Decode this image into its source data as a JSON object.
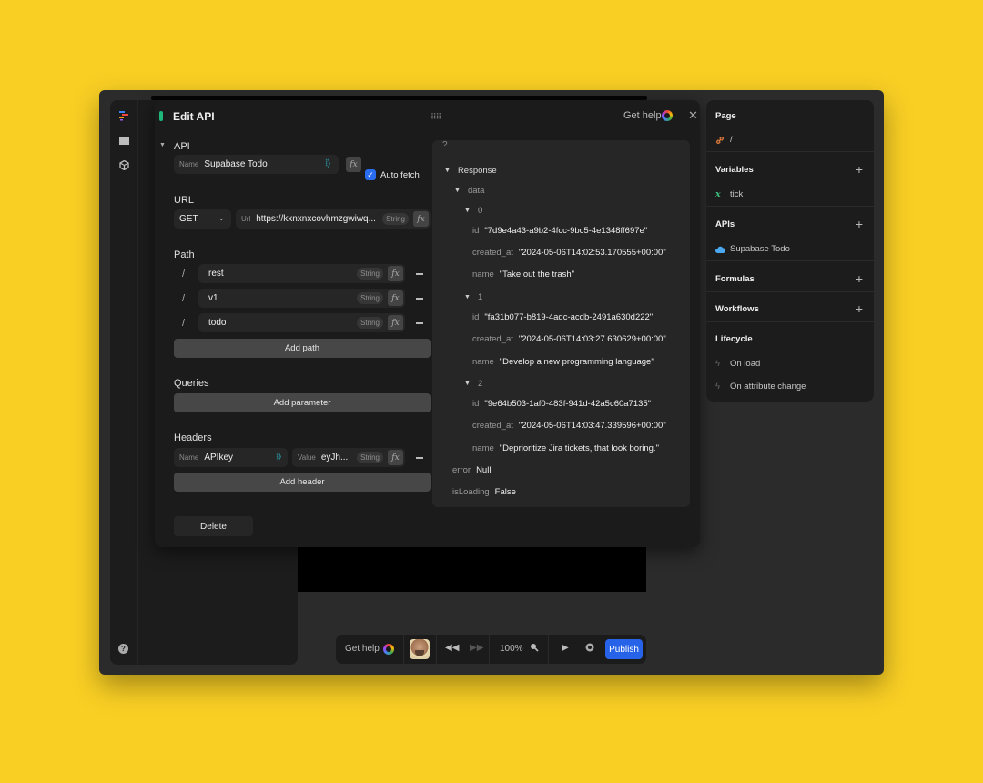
{
  "panel": {
    "title": "Edit API",
    "get_help": "Get help",
    "api_section": "API",
    "name_label": "Name",
    "name_value": "Supabase Todo",
    "fx": "fx",
    "auto_fetch_label": "Auto fetch",
    "auto_fetch_checked": true,
    "url_section": "URL",
    "method": "GET",
    "url_label": "Url",
    "url_value": "https://kxnxnxcovhmzgwiwq...",
    "string_badge": "String",
    "path_section": "Path",
    "path_slash": "/",
    "paths": [
      {
        "value": "rest",
        "type": "String"
      },
      {
        "value": "v1",
        "type": "String"
      },
      {
        "value": "todo",
        "type": "String"
      }
    ],
    "add_path": "Add path",
    "queries_section": "Queries",
    "add_parameter": "Add parameter",
    "headers_section": "Headers",
    "header": {
      "name_label": "Name",
      "name_value": "APIkey",
      "value_label": "Value",
      "value_value": "eyJh...",
      "type": "String"
    },
    "add_header": "Add header",
    "delete": "Delete"
  },
  "response": {
    "question": "?",
    "root": "Response",
    "data_key": "data",
    "items": [
      {
        "index": "0",
        "id": "\"7d9e4a43-a9b2-4fcc-9bc5-4e1348ff697e\"",
        "created_at": "\"2024-05-06T14:02:53.170555+00:00\"",
        "name": "\"Take out the trash\""
      },
      {
        "index": "1",
        "id": "\"fa31b077-b819-4adc-acdb-2491a630d222\"",
        "created_at": "\"2024-05-06T14:03:27.630629+00:00\"",
        "name": "\"Develop a new programming language\""
      },
      {
        "index": "2",
        "id": "\"9e64b503-1af0-483f-941d-42a5c60a7135\"",
        "created_at": "\"2024-05-06T14:03:47.339596+00:00\"",
        "name": "\"Deprioritize Jira tickets, that look boring.\""
      }
    ],
    "keys": {
      "id": "id",
      "created_at": "created_at",
      "name": "name"
    },
    "error_key": "error",
    "error_value": "Null",
    "loading_key": "isLoading",
    "loading_value": "False"
  },
  "right_panel": {
    "page_title": "Page",
    "page_path": "/",
    "variables_title": "Variables",
    "variables": [
      "tick"
    ],
    "apis_title": "APIs",
    "apis": [
      "Supabase Todo"
    ],
    "formulas_title": "Formulas",
    "workflows_title": "Workflows",
    "lifecycle_title": "Lifecycle",
    "lifecycle": [
      "On load",
      "On attribute change"
    ]
  },
  "bottom_bar": {
    "get_help": "Get help",
    "zoom": "100%",
    "publish": "Publish"
  },
  "colors": {
    "background": "#f9cf24",
    "accent_blue": "#2763e8",
    "green_pill": "#1db87a"
  }
}
